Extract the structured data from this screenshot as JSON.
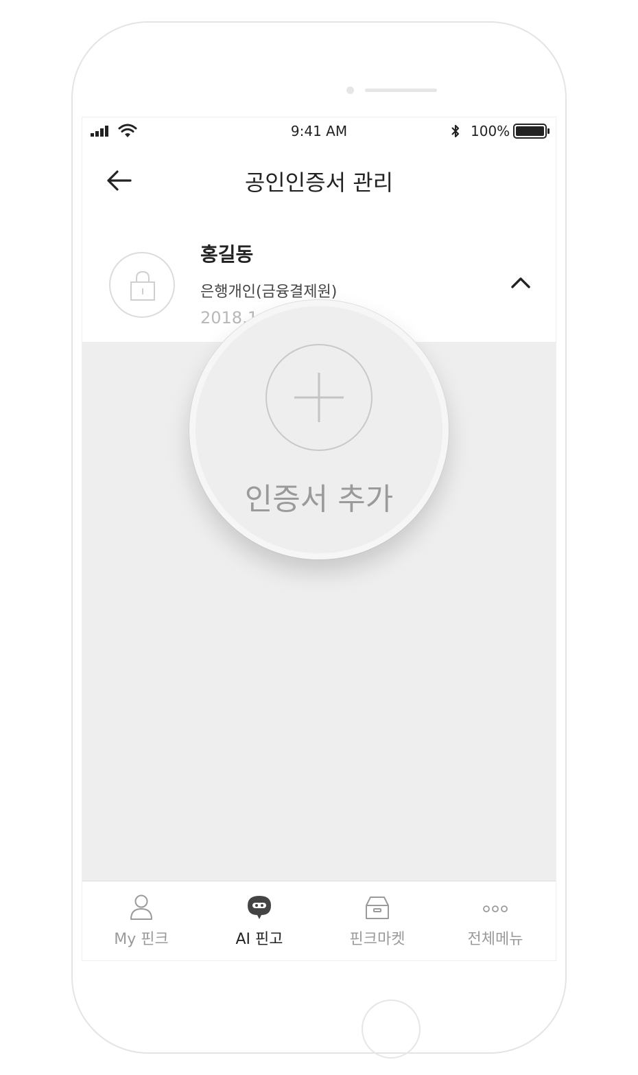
{
  "status_bar": {
    "time": "9:41 AM",
    "battery": "100%"
  },
  "header": {
    "title": "공인인증서 관리"
  },
  "certificate": {
    "name": "홍길동",
    "issuer": "은행개인(금융결제원)",
    "expiry": "2018.1"
  },
  "magnifier": {
    "add_label": "인증서 추가"
  },
  "tab_bar": {
    "tabs": [
      {
        "label": "My 핀크",
        "icon": "person-icon"
      },
      {
        "label": "AI 핀고",
        "icon": "chatbot-icon"
      },
      {
        "label": "핀크마켓",
        "icon": "market-box-icon"
      },
      {
        "label": "전체메뉴",
        "icon": "more-dots-icon"
      }
    ],
    "active_index": 1
  }
}
